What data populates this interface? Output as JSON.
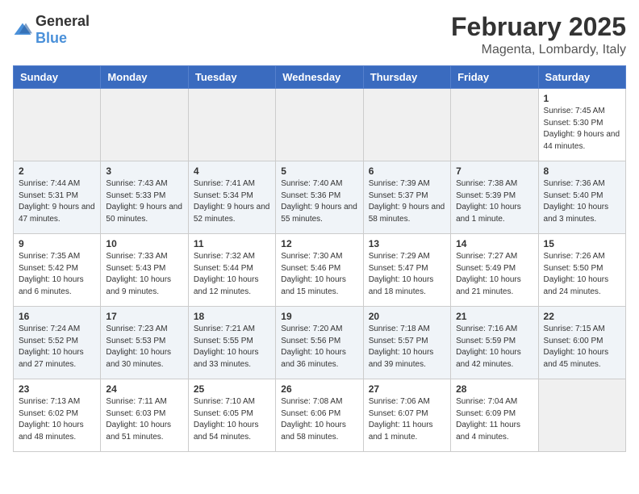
{
  "header": {
    "logo_general": "General",
    "logo_blue": "Blue",
    "month": "February 2025",
    "location": "Magenta, Lombardy, Italy"
  },
  "weekdays": [
    "Sunday",
    "Monday",
    "Tuesday",
    "Wednesday",
    "Thursday",
    "Friday",
    "Saturday"
  ],
  "weeks": [
    [
      {
        "day": "",
        "info": ""
      },
      {
        "day": "",
        "info": ""
      },
      {
        "day": "",
        "info": ""
      },
      {
        "day": "",
        "info": ""
      },
      {
        "day": "",
        "info": ""
      },
      {
        "day": "",
        "info": ""
      },
      {
        "day": "1",
        "info": "Sunrise: 7:45 AM\nSunset: 5:30 PM\nDaylight: 9 hours and 44 minutes."
      }
    ],
    [
      {
        "day": "2",
        "info": "Sunrise: 7:44 AM\nSunset: 5:31 PM\nDaylight: 9 hours and 47 minutes."
      },
      {
        "day": "3",
        "info": "Sunrise: 7:43 AM\nSunset: 5:33 PM\nDaylight: 9 hours and 50 minutes."
      },
      {
        "day": "4",
        "info": "Sunrise: 7:41 AM\nSunset: 5:34 PM\nDaylight: 9 hours and 52 minutes."
      },
      {
        "day": "5",
        "info": "Sunrise: 7:40 AM\nSunset: 5:36 PM\nDaylight: 9 hours and 55 minutes."
      },
      {
        "day": "6",
        "info": "Sunrise: 7:39 AM\nSunset: 5:37 PM\nDaylight: 9 hours and 58 minutes."
      },
      {
        "day": "7",
        "info": "Sunrise: 7:38 AM\nSunset: 5:39 PM\nDaylight: 10 hours and 1 minute."
      },
      {
        "day": "8",
        "info": "Sunrise: 7:36 AM\nSunset: 5:40 PM\nDaylight: 10 hours and 3 minutes."
      }
    ],
    [
      {
        "day": "9",
        "info": "Sunrise: 7:35 AM\nSunset: 5:42 PM\nDaylight: 10 hours and 6 minutes."
      },
      {
        "day": "10",
        "info": "Sunrise: 7:33 AM\nSunset: 5:43 PM\nDaylight: 10 hours and 9 minutes."
      },
      {
        "day": "11",
        "info": "Sunrise: 7:32 AM\nSunset: 5:44 PM\nDaylight: 10 hours and 12 minutes."
      },
      {
        "day": "12",
        "info": "Sunrise: 7:30 AM\nSunset: 5:46 PM\nDaylight: 10 hours and 15 minutes."
      },
      {
        "day": "13",
        "info": "Sunrise: 7:29 AM\nSunset: 5:47 PM\nDaylight: 10 hours and 18 minutes."
      },
      {
        "day": "14",
        "info": "Sunrise: 7:27 AM\nSunset: 5:49 PM\nDaylight: 10 hours and 21 minutes."
      },
      {
        "day": "15",
        "info": "Sunrise: 7:26 AM\nSunset: 5:50 PM\nDaylight: 10 hours and 24 minutes."
      }
    ],
    [
      {
        "day": "16",
        "info": "Sunrise: 7:24 AM\nSunset: 5:52 PM\nDaylight: 10 hours and 27 minutes."
      },
      {
        "day": "17",
        "info": "Sunrise: 7:23 AM\nSunset: 5:53 PM\nDaylight: 10 hours and 30 minutes."
      },
      {
        "day": "18",
        "info": "Sunrise: 7:21 AM\nSunset: 5:55 PM\nDaylight: 10 hours and 33 minutes."
      },
      {
        "day": "19",
        "info": "Sunrise: 7:20 AM\nSunset: 5:56 PM\nDaylight: 10 hours and 36 minutes."
      },
      {
        "day": "20",
        "info": "Sunrise: 7:18 AM\nSunset: 5:57 PM\nDaylight: 10 hours and 39 minutes."
      },
      {
        "day": "21",
        "info": "Sunrise: 7:16 AM\nSunset: 5:59 PM\nDaylight: 10 hours and 42 minutes."
      },
      {
        "day": "22",
        "info": "Sunrise: 7:15 AM\nSunset: 6:00 PM\nDaylight: 10 hours and 45 minutes."
      }
    ],
    [
      {
        "day": "23",
        "info": "Sunrise: 7:13 AM\nSunset: 6:02 PM\nDaylight: 10 hours and 48 minutes."
      },
      {
        "day": "24",
        "info": "Sunrise: 7:11 AM\nSunset: 6:03 PM\nDaylight: 10 hours and 51 minutes."
      },
      {
        "day": "25",
        "info": "Sunrise: 7:10 AM\nSunset: 6:05 PM\nDaylight: 10 hours and 54 minutes."
      },
      {
        "day": "26",
        "info": "Sunrise: 7:08 AM\nSunset: 6:06 PM\nDaylight: 10 hours and 58 minutes."
      },
      {
        "day": "27",
        "info": "Sunrise: 7:06 AM\nSunset: 6:07 PM\nDaylight: 11 hours and 1 minute."
      },
      {
        "day": "28",
        "info": "Sunrise: 7:04 AM\nSunset: 6:09 PM\nDaylight: 11 hours and 4 minutes."
      },
      {
        "day": "",
        "info": ""
      }
    ]
  ]
}
